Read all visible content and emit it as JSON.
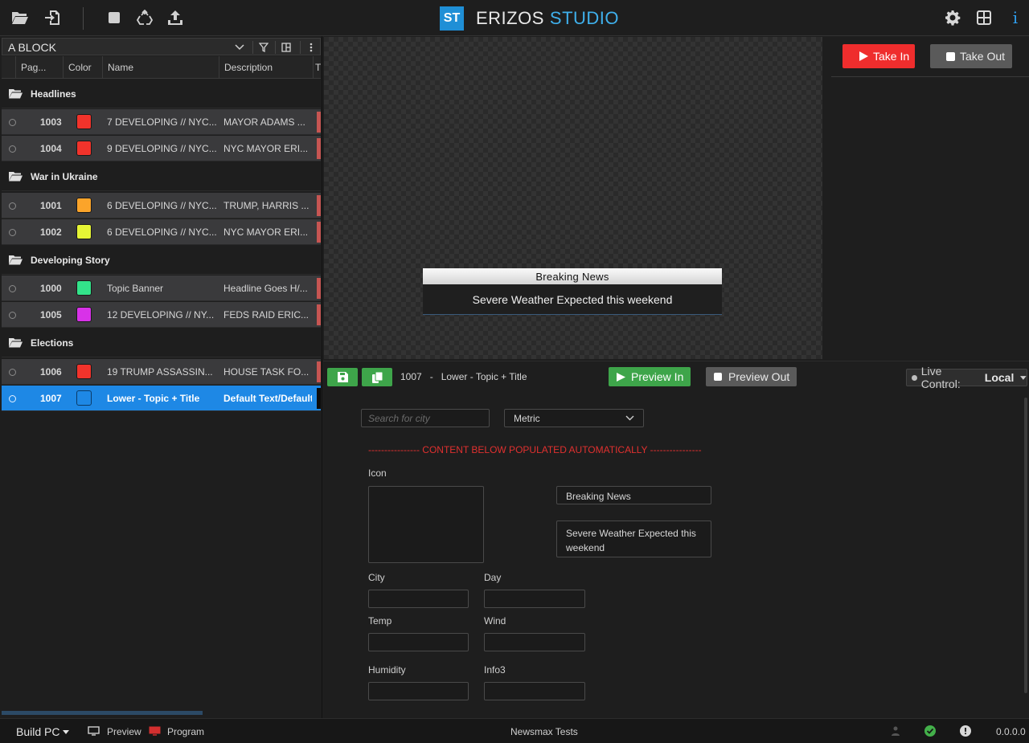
{
  "app": {
    "logo_mark": "ST",
    "title_part1": "ERIZOS",
    "title_part2": "STUDIO",
    "brand_color": "#1f8fd6",
    "accent_color": "#3fb0ec"
  },
  "toolbar": {
    "left_icons": [
      "folder-open-icon",
      "import-icon",
      "stop-icon",
      "recycle-icon",
      "upload-icon"
    ],
    "right_icons": [
      "gear-icon",
      "grid-icon",
      "info-icon"
    ],
    "info_label": "i"
  },
  "playlist": {
    "block_name": "A BLOCK",
    "columns": [
      "Pag...",
      "Color",
      "Name",
      "Description",
      "T"
    ],
    "groups": [
      {
        "name": "Headlines",
        "items": [
          {
            "page": "1003",
            "color": "#f2332b",
            "name": "7 DEVELOPING // NYC...",
            "description": "MAYOR ADAMS ..."
          },
          {
            "page": "1004",
            "color": "#f2332b",
            "name": "9 DEVELOPING // NYC...",
            "description": "NYC MAYOR ERI..."
          }
        ]
      },
      {
        "name": "War in Ukraine",
        "items": [
          {
            "page": "1001",
            "color": "#fba42a",
            "name": "6 DEVELOPING // NYC...",
            "description": "TRUMP, HARRIS ..."
          },
          {
            "page": "1002",
            "color": "#e6f535",
            "name": "6 DEVELOPING // NYC...",
            "description": "NYC MAYOR ERI..."
          }
        ]
      },
      {
        "name": "Developing Story",
        "items": [
          {
            "page": "1000",
            "color": "#33e38a",
            "name": "Topic Banner",
            "description": "Headline Goes H/..."
          },
          {
            "page": "1005",
            "color": "#d832e8",
            "name": "12 DEVELOPING // NY...",
            "description": "FEDS RAID ERIC..."
          }
        ]
      },
      {
        "name": "Elections",
        "items": [
          {
            "page": "1006",
            "color": "#f2332b",
            "name": "19 TRUMP ASSASSIN...",
            "description": "HOUSE TASK FO..."
          },
          {
            "page": "1007",
            "color": "#1e88e5",
            "name": "Lower - Topic + Title",
            "description": "Default Text/Default T",
            "selected": true
          }
        ]
      }
    ]
  },
  "preview": {
    "lower_third_title": "Breaking News",
    "lower_third_text": "Severe Weather Expected this weekend"
  },
  "output": {
    "take_in": "Take In",
    "take_out": "Take Out"
  },
  "editor": {
    "page_info": "1007   -   Lower - Topic + Title",
    "preview_in": "Preview In",
    "preview_out": "Preview Out",
    "live_control_label": "Live Control:",
    "live_control_value": "Local",
    "search_placeholder": "Search for city",
    "units": "Metric",
    "auto_note": "---------------- CONTENT BELOW POPULATED AUTOMATICALLY ----------------",
    "icon_label": "Icon",
    "title_field": "Breaking News",
    "text_field": "Severe Weather Expected this weekend",
    "labels": {
      "city": "City",
      "day": "Day",
      "temp": "Temp",
      "wind": "Wind",
      "humidity": "Humidity",
      "info3": "Info3"
    }
  },
  "status": {
    "build": "Build PC",
    "preview": "Preview",
    "program": "Program",
    "project": "Newsmax Tests",
    "version": "0.0.0.0"
  }
}
